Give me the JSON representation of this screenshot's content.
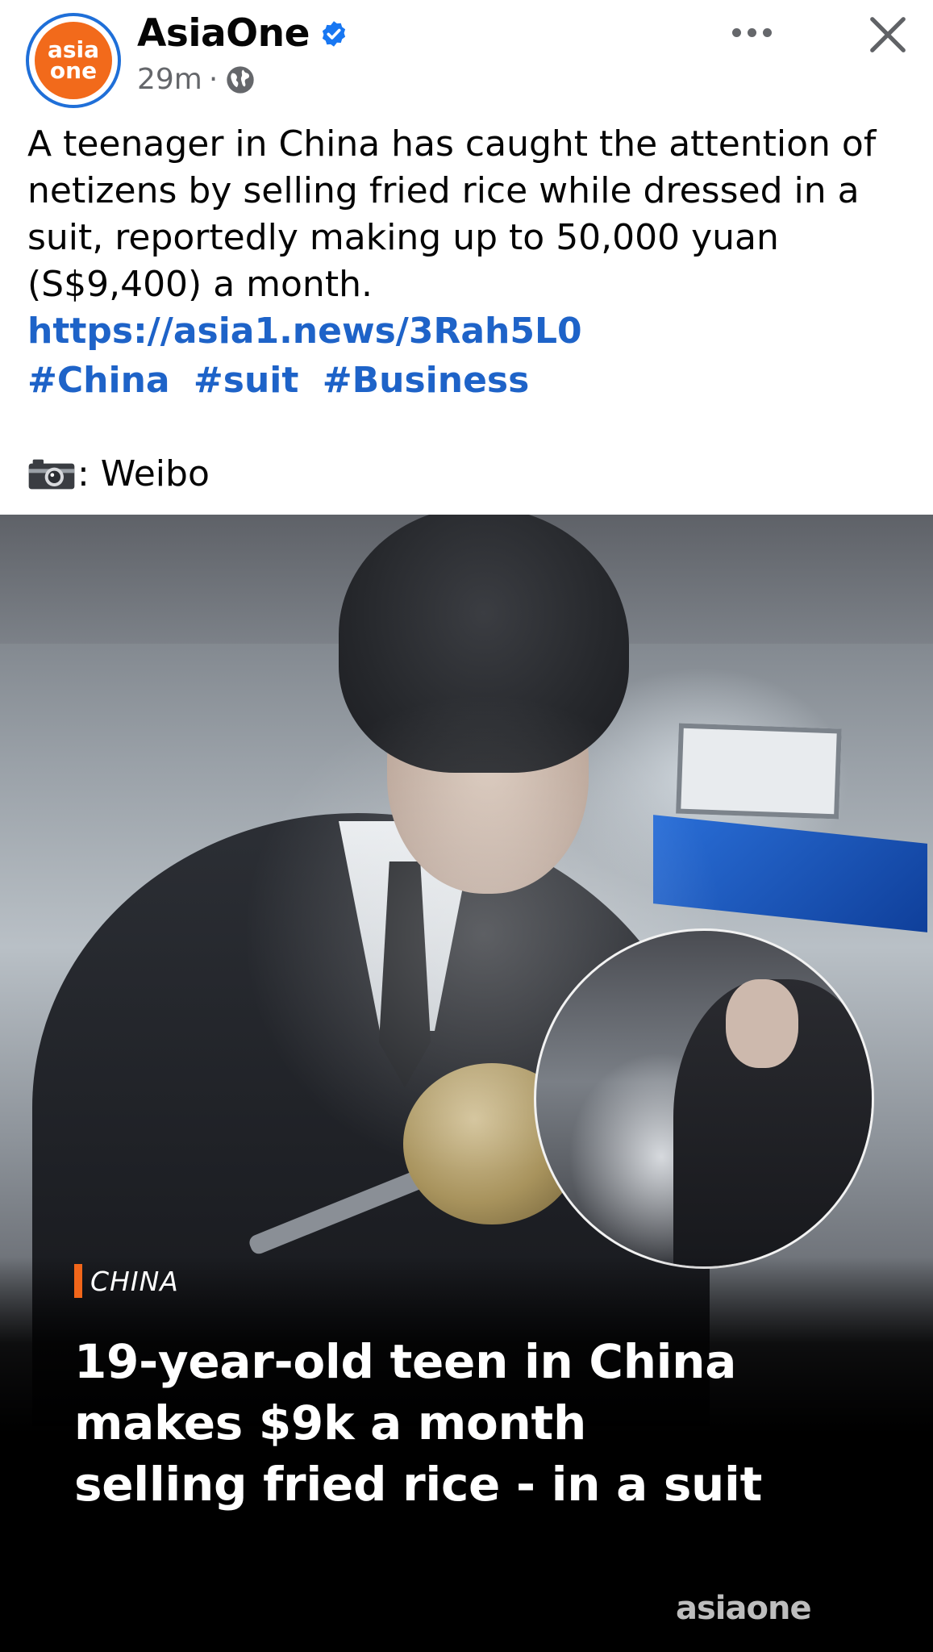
{
  "post": {
    "page_name": "AsiaOne",
    "avatar_text_top": "asia",
    "avatar_text_bottom": "one",
    "time": "29m",
    "separator": "·",
    "privacy_icon": "globe-icon",
    "verified_icon": "verified-badge-icon",
    "more_icon": "more-horizontal-icon",
    "close_icon": "close-icon",
    "body_text": "A teenager in China has caught the attention of netizens by selling fried rice while dressed in a suit, reportedly making up to 50,000 yuan (S$9,400) a month. ",
    "link": "https://asia1.news/3Rah5L0",
    "hashtags": [
      "#China",
      "#suit",
      "#Business"
    ],
    "credit_icon": "camera-icon",
    "credit_text": ": Weibo"
  },
  "media": {
    "category": "CHINA",
    "headline_lines": [
      "19-year-old teen in China",
      "makes $9k a month",
      "selling fried rice - in a suit"
    ],
    "watermark": "asiaone"
  },
  "colors": {
    "brand_orange": "#f26a1b",
    "link_blue": "#1e63c8",
    "verified_blue": "#1877f2",
    "text_primary": "#050505",
    "text_secondary": "#65676b"
  }
}
